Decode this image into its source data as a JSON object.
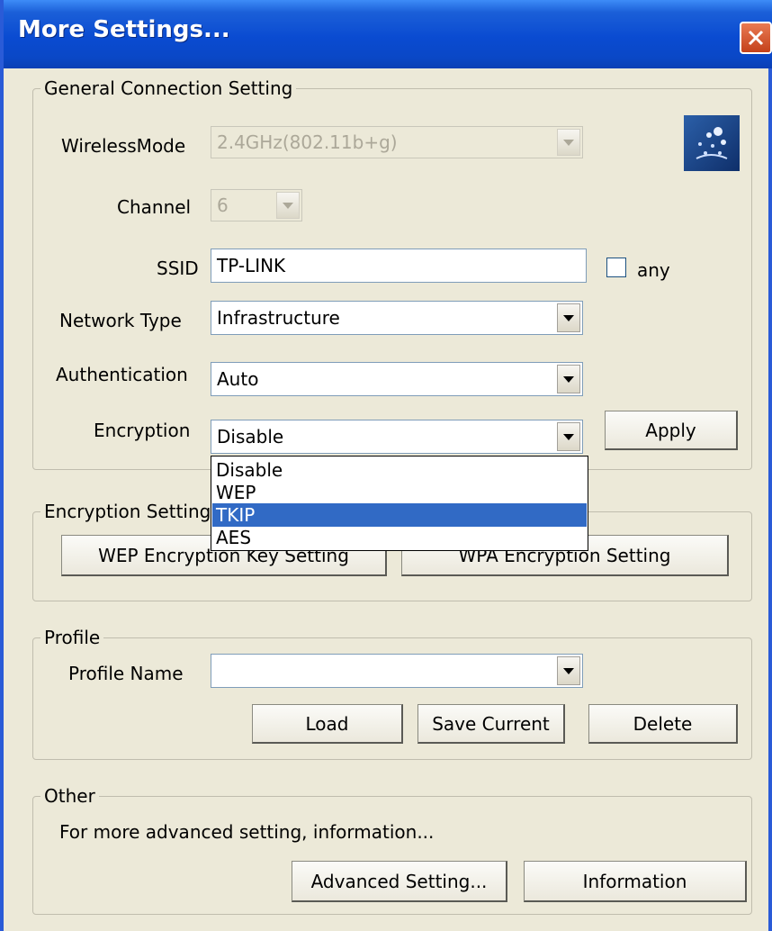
{
  "window": {
    "title": "More Settings..."
  },
  "general": {
    "legend": "General Connection Setting",
    "wireless_mode_label": "WirelessMode",
    "wireless_mode_value": "2.4GHz(802.11b+g)",
    "channel_label": "Channel",
    "channel_value": "6",
    "ssid_label": "SSID",
    "ssid_value": "TP-LINK",
    "any_label": "any",
    "network_type_label": "Network Type",
    "network_type_value": "Infrastructure",
    "authentication_label": "Authentication",
    "authentication_value": "Auto",
    "encryption_label": "Encryption",
    "encryption_value": "Disable",
    "apply_label": "Apply"
  },
  "encryption_dropdown": {
    "options": [
      "Disable",
      "WEP",
      "TKIP",
      "AES"
    ],
    "highlighted": "TKIP"
  },
  "encryption_settings": {
    "legend": "Encryption Setting",
    "wep_button": "WEP Encryption Key Setting",
    "wpa_button": "WPA Encryption Setting"
  },
  "profile": {
    "legend": "Profile",
    "name_label": "Profile Name",
    "name_value": "",
    "load_label": "Load",
    "save_label": "Save Current",
    "delete_label": "Delete"
  },
  "other": {
    "legend": "Other",
    "description": "For more advanced setting, information...",
    "advanced_label": "Advanced Setting...",
    "information_label": "Information"
  },
  "icons": {
    "close": "close-icon",
    "logo": "wireless-logo-icon",
    "dropdown": "chevron-down-icon"
  },
  "colors": {
    "titlebar": "#0a4bd1",
    "selection": "#316ac5",
    "close": "#c4411b"
  }
}
